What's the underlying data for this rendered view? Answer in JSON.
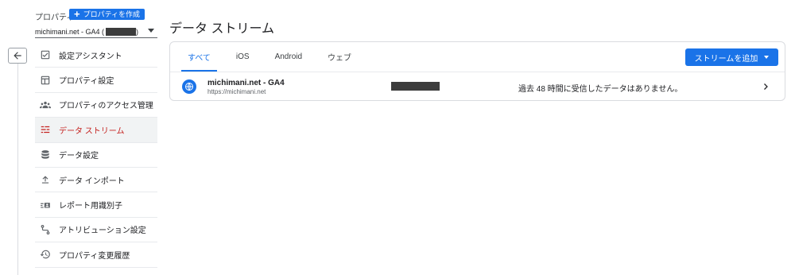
{
  "property": {
    "label": "プロパティ",
    "create_button": "プロパティを作成",
    "create_plus": "+",
    "selected_prefix": "michimani.net - GA4 (",
    "selected_suffix": ")"
  },
  "nav": {
    "items": [
      {
        "label": "設定アシスタント",
        "icon": "checklist-icon"
      },
      {
        "label": "プロパティ設定",
        "icon": "layout-icon"
      },
      {
        "label": "プロパティのアクセス管理",
        "icon": "people-icon"
      },
      {
        "label": "データ ストリーム",
        "icon": "streams-icon",
        "active": true
      },
      {
        "label": "データ設定",
        "icon": "database-icon"
      },
      {
        "label": "データ インポート",
        "icon": "upload-icon"
      },
      {
        "label": "レポート用識別子",
        "icon": "identity-icon"
      },
      {
        "label": "アトリビューション設定",
        "icon": "attribution-icon"
      },
      {
        "label": "プロパティ変更履歴",
        "icon": "history-icon"
      }
    ]
  },
  "main": {
    "title": "データ ストリーム",
    "tabs": [
      {
        "label": "すべて",
        "active": true
      },
      {
        "label": "iOS"
      },
      {
        "label": "Android"
      },
      {
        "label": "ウェブ"
      }
    ],
    "add_stream_button": "ストリームを追加",
    "stream": {
      "name": "michimani.net - GA4",
      "url": "https://michimani.net",
      "status": "過去 48 時間に受信したデータはありません。"
    }
  },
  "colors": {
    "accent": "#1a73e8",
    "active_nav": "#c5221f"
  }
}
